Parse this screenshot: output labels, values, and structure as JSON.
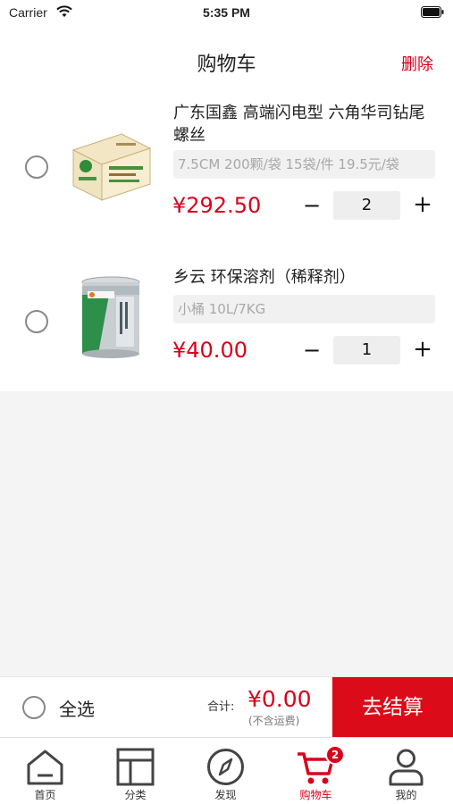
{
  "status_bar": {
    "carrier": "Carrier",
    "time": "5:35 PM"
  },
  "nav": {
    "title": "购物车",
    "delete_label": "删除"
  },
  "cart": {
    "items": [
      {
        "name": "广东国鑫 高端闪电型 六角华司钻尾螺丝",
        "spec": "7.5CM 200颗/袋 15袋/件 19.5元/袋",
        "price": "¥292.50",
        "quantity": "2",
        "image": "screw-box-image"
      },
      {
        "name": "乡云 环保溶剂（稀释剂）",
        "spec": "小桶 10L/7KG",
        "price": "¥40.00",
        "quantity": "1",
        "image": "solvent-can-image"
      }
    ],
    "qty_minus": "−",
    "qty_plus": "+"
  },
  "bottom_bar": {
    "select_all_label": "全选",
    "total_label": "合计:",
    "total_value": "¥0.00",
    "shipping_note": "(不含运费)",
    "checkout_label": "去结算"
  },
  "tabs": [
    {
      "label": "首页",
      "icon": "home-icon"
    },
    {
      "label": "分类",
      "icon": "category-icon"
    },
    {
      "label": "发现",
      "icon": "compass-icon"
    },
    {
      "label": "购物车",
      "icon": "cart-icon",
      "badge": "2",
      "active": true
    },
    {
      "label": "我的",
      "icon": "user-icon"
    }
  ],
  "colors": {
    "accent": "#d9001b",
    "checkout_bg": "#dc0b19",
    "spec_text": "#a8a8a8"
  }
}
